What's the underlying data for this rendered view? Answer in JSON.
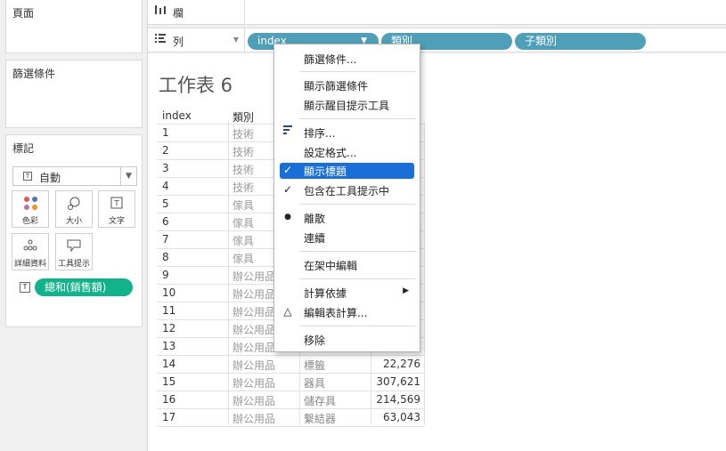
{
  "left": {
    "pages_title": "頁面",
    "filters_title": "篩選條件",
    "marks_title": "標記",
    "mark_type": {
      "icon": "T",
      "label": "自動"
    },
    "buttons": {
      "color": "色彩",
      "size": "大小",
      "text": "文字",
      "detail": "詳細資料",
      "tooltip": "工具提示"
    },
    "measure_icon": "T",
    "measure_pill": "總和(銷售額)"
  },
  "shelves": {
    "columns_label": "欄",
    "rows_label": "列",
    "pills": [
      "index",
      "類別",
      "子類別"
    ]
  },
  "sheet": {
    "title": "工作表 6",
    "headers": [
      "index",
      "類別"
    ],
    "rows": [
      {
        "idx": "1",
        "cat": "技術",
        "sub": "",
        "val": ""
      },
      {
        "idx": "2",
        "cat": "技術",
        "sub": "",
        "val": ""
      },
      {
        "idx": "3",
        "cat": "技術",
        "sub": "",
        "val": ""
      },
      {
        "idx": "4",
        "cat": "技術",
        "sub": "",
        "val": ""
      },
      {
        "idx": "5",
        "cat": "傢具",
        "sub": "",
        "val": ""
      },
      {
        "idx": "6",
        "cat": "傢具",
        "sub": "",
        "val": ""
      },
      {
        "idx": "7",
        "cat": "傢具",
        "sub": "",
        "val": ""
      },
      {
        "idx": "8",
        "cat": "傢具",
        "sub": "",
        "val": ""
      },
      {
        "idx": "9",
        "cat": "辦公用品",
        "sub": "",
        "val": ""
      },
      {
        "idx": "10",
        "cat": "辦公用品",
        "sub": "",
        "val": ""
      },
      {
        "idx": "11",
        "cat": "辦公用品",
        "sub": "",
        "val": ""
      },
      {
        "idx": "12",
        "cat": "辦公用品",
        "sub": "",
        "val": ""
      },
      {
        "idx": "13",
        "cat": "辦公用品",
        "sub": "",
        "val": ""
      },
      {
        "idx": "14",
        "cat": "辦公用品",
        "sub": "標籤",
        "val": "22,276"
      },
      {
        "idx": "15",
        "cat": "辦公用品",
        "sub": "器具",
        "val": "307,621"
      },
      {
        "idx": "16",
        "cat": "辦公用品",
        "sub": "儲存具",
        "val": "214,569"
      },
      {
        "idx": "17",
        "cat": "辦公用品",
        "sub": "繫結器",
        "val": "63,043"
      }
    ]
  },
  "menu": {
    "items": [
      {
        "label": "篩選條件...",
        "mark": ""
      },
      {
        "label": "顯示篩選條件",
        "mark": ""
      },
      {
        "label": "顯示醒目提示工具",
        "mark": ""
      },
      {
        "label": "排序...",
        "mark": "sort-icon"
      },
      {
        "label": "設定格式...",
        "mark": ""
      },
      {
        "label": "顯示標題",
        "mark": "✓"
      },
      {
        "label": "包含在工具提示中",
        "mark": "✓"
      },
      {
        "label": "離散",
        "mark": "●"
      },
      {
        "label": "連續",
        "mark": ""
      },
      {
        "label": "在架中編輯",
        "mark": ""
      },
      {
        "label": "計算依據",
        "mark": ""
      },
      {
        "label": "編輯表計算...",
        "mark": "△"
      },
      {
        "label": "移除",
        "mark": ""
      }
    ]
  },
  "colors": {
    "pill_blue": "#4f9fb8",
    "pill_green": "#12b38a",
    "menu_highlight": "#1a6fd6"
  }
}
